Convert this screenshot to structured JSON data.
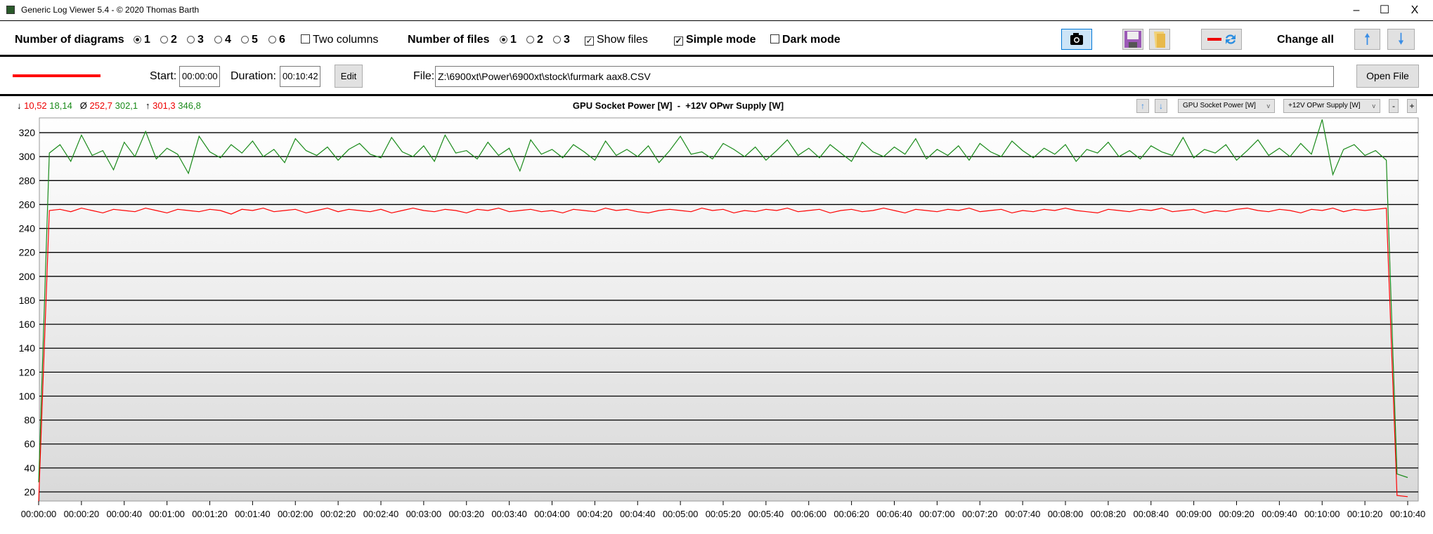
{
  "window": {
    "title": "Generic Log Viewer 5.4 - © 2020 Thomas Barth",
    "minimize": "–",
    "maximize": "☐",
    "close": "X"
  },
  "toolbar": {
    "diagrams_label": "Number of diagrams",
    "diagram_options": [
      "1",
      "2",
      "3",
      "4",
      "5",
      "6"
    ],
    "diagram_selected": "1",
    "two_columns": "Two columns",
    "two_columns_checked": false,
    "files_label": "Number of files",
    "file_options": [
      "1",
      "2",
      "3"
    ],
    "file_selected": "1",
    "show_files": "Show files",
    "show_files_checked": true,
    "simple_mode": "Simple mode",
    "simple_mode_checked": true,
    "dark_mode": "Dark mode",
    "dark_mode_checked": false,
    "change_all": "Change all"
  },
  "file_row": {
    "line_color": "#ff0000",
    "start_label": "Start:",
    "start_value": "00:00:00",
    "duration_label": "Duration:",
    "duration_value": "00:10:42",
    "edit": "Edit",
    "file_label": "File:",
    "file_path": "Z:\\6900xt\\Power\\6900xt\\stock\\furmark aax8.CSV",
    "open_file": "Open File"
  },
  "stats": {
    "min_symbol": "↓",
    "min_red": "10,52",
    "min_green": "18,14",
    "avg_symbol": "Ø",
    "avg_red": "252,7",
    "avg_green": "302,1",
    "max_symbol": "↑",
    "max_red": "301,3",
    "max_green": "346,8"
  },
  "diagram_controls": {
    "select1": "GPU Socket Power [W]",
    "select2": "+12V OPwr Supply [W]",
    "minus": "-",
    "plus": "+"
  },
  "chart_data": {
    "type": "line",
    "title": "GPU Socket Power [W]  -  +12V OPwr Supply [W]",
    "ylim": [
      10,
      330
    ],
    "y_ticks": [
      20,
      40,
      60,
      80,
      100,
      120,
      140,
      160,
      180,
      200,
      220,
      240,
      260,
      280,
      300,
      320
    ],
    "x_range_seconds": [
      0,
      640
    ],
    "x_ticks": [
      "00:00:00",
      "00:00:20",
      "00:00:40",
      "00:01:00",
      "00:01:20",
      "00:01:40",
      "00:02:00",
      "00:02:20",
      "00:02:40",
      "00:03:00",
      "00:03:20",
      "00:03:40",
      "00:04:00",
      "00:04:20",
      "00:04:40",
      "00:05:00",
      "00:05:20",
      "00:05:40",
      "00:06:00",
      "00:06:20",
      "00:06:40",
      "00:07:00",
      "00:07:20",
      "00:07:40",
      "00:08:00",
      "00:08:20",
      "00:08:40",
      "00:09:00",
      "00:09:20",
      "00:09:40",
      "00:10:00",
      "00:10:20",
      "00:10:40"
    ],
    "x_step_seconds": 5,
    "series": [
      {
        "name": "GPU Socket Power [W]",
        "color": "#ff0000",
        "values": [
          12,
          255,
          256,
          254,
          257,
          255,
          253,
          256,
          255,
          254,
          257,
          255,
          253,
          256,
          255,
          254,
          256,
          255,
          252,
          256,
          255,
          257,
          254,
          255,
          256,
          253,
          255,
          257,
          254,
          256,
          255,
          254,
          256,
          253,
          255,
          257,
          255,
          254,
          256,
          255,
          253,
          256,
          255,
          257,
          254,
          255,
          256,
          254,
          255,
          253,
          256,
          255,
          254,
          257,
          255,
          256,
          254,
          253,
          255,
          256,
          255,
          254,
          257,
          255,
          256,
          253,
          255,
          254,
          256,
          255,
          257,
          254,
          255,
          256,
          253,
          255,
          256,
          254,
          255,
          257,
          255,
          253,
          256,
          255,
          254,
          256,
          255,
          257,
          254,
          255,
          256,
          253,
          255,
          254,
          256,
          255,
          257,
          255,
          254,
          253,
          256,
          255,
          254,
          256,
          255,
          257,
          254,
          255,
          256,
          253,
          255,
          254,
          256,
          257,
          255,
          254,
          256,
          255,
          253,
          256,
          255,
          257,
          254,
          256,
          255,
          256,
          257,
          17,
          16
        ]
      },
      {
        "name": "+12V OPwr Supply [W]",
        "color": "#1a8a1a",
        "values": [
          28,
          303,
          310,
          296,
          318,
          301,
          305,
          289,
          312,
          300,
          321,
          298,
          307,
          302,
          286,
          317,
          304,
          299,
          310,
          303,
          313,
          300,
          306,
          295,
          315,
          305,
          301,
          308,
          297,
          306,
          311,
          302,
          299,
          316,
          304,
          300,
          309,
          296,
          318,
          303,
          305,
          298,
          312,
          301,
          307,
          288,
          314,
          302,
          306,
          299,
          310,
          304,
          297,
          313,
          301,
          306,
          300,
          309,
          295,
          305,
          317,
          302,
          304,
          298,
          311,
          306,
          300,
          308,
          297,
          305,
          314,
          301,
          307,
          299,
          310,
          303,
          296,
          312,
          304,
          300,
          308,
          302,
          315,
          298,
          306,
          301,
          309,
          297,
          311,
          304,
          300,
          313,
          305,
          299,
          307,
          302,
          310,
          296,
          306,
          303,
          312,
          300,
          305,
          298,
          309,
          304,
          301,
          316,
          299,
          306,
          303,
          310,
          297,
          305,
          314,
          301,
          307,
          300,
          311,
          302,
          331,
          285,
          306,
          310,
          301,
          305,
          297,
          35,
          32
        ]
      }
    ]
  }
}
